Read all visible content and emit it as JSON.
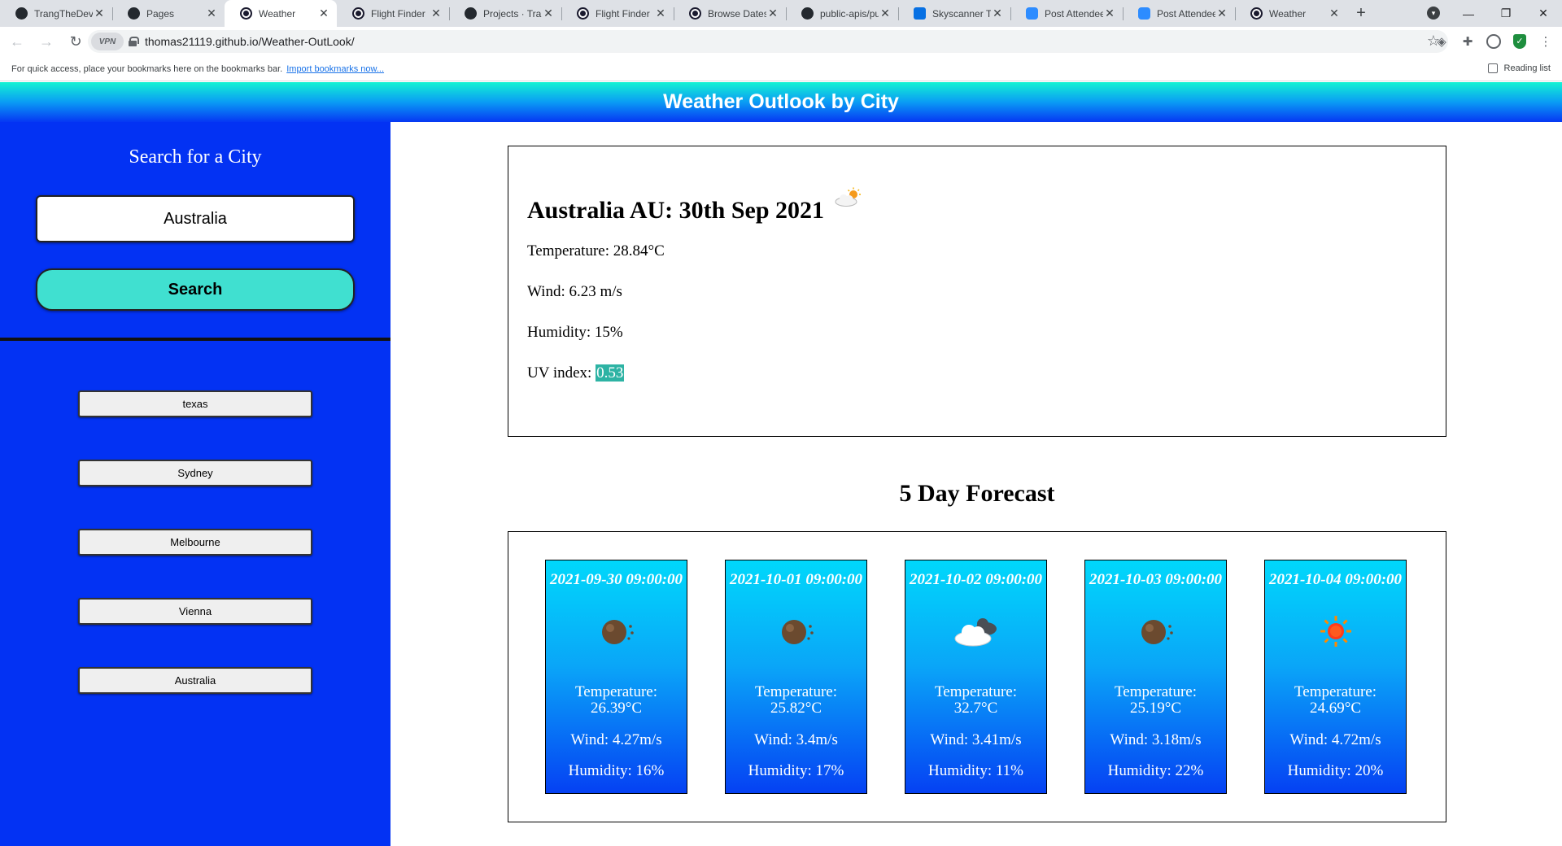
{
  "browser": {
    "tabs": [
      {
        "title": "TrangTheDev",
        "icon": "github-icon"
      },
      {
        "title": "Pages",
        "icon": "github-icon"
      },
      {
        "title": "Weather",
        "icon": "globe-icon",
        "active": true
      },
      {
        "title": "Flight Finder",
        "icon": "globe-icon"
      },
      {
        "title": "Projects · Tran",
        "icon": "github-icon"
      },
      {
        "title": "Flight Finder",
        "icon": "globe-icon"
      },
      {
        "title": "Browse Dates",
        "icon": "globe-icon"
      },
      {
        "title": "public-apis/pu",
        "icon": "github-icon"
      },
      {
        "title": "Skyscanner Tr",
        "icon": "skyscanner-icon"
      },
      {
        "title": "Post Attendee",
        "icon": "zoom-icon"
      },
      {
        "title": "Post Attendee",
        "icon": "zoom-icon"
      },
      {
        "title": "Weather",
        "icon": "globe-icon"
      }
    ],
    "vpn_label": "VPN",
    "url": "thomas21119.github.io/Weather-OutLook/",
    "bookmarks_prompt": "For quick access, place your bookmarks here on the bookmarks bar.",
    "bookmarks_link": "Import bookmarks now...",
    "reading_list": "Reading list"
  },
  "app": {
    "title": "Weather Outlook by City"
  },
  "sidebar": {
    "heading": "Search for a City",
    "search_value": "Australia",
    "search_button": "Search",
    "history": [
      "texas",
      "Sydney",
      "Melbourne",
      "Vienna",
      "Australia"
    ]
  },
  "current": {
    "heading": "Australia AU: 30th Sep 2021",
    "icon": "partly-cloudy-icon",
    "temperature": "Temperature: 28.84°C",
    "wind": "Wind: 6.23 m/s",
    "humidity": "Humidity: 15%",
    "uv_label": "UV index:",
    "uv_value": "0.53",
    "uv_color": "#2db3a4"
  },
  "forecast": {
    "title": "5 Day Forecast",
    "days": [
      {
        "date": "2021-09-30 09:00:00",
        "icon": "dust-icon",
        "temp_label": "Temperature:",
        "temp": "26.39°C",
        "wind": "Wind: 4.27m/s",
        "humidity": "Humidity: 16%"
      },
      {
        "date": "2021-10-01 09:00:00",
        "icon": "dust-icon",
        "temp_label": "Temperature:",
        "temp": "25.82°C",
        "wind": "Wind: 3.4m/s",
        "humidity": "Humidity: 17%"
      },
      {
        "date": "2021-10-02 09:00:00",
        "icon": "broken-clouds-icon",
        "temp_label": "Temperature:",
        "temp": "32.7°C",
        "wind": "Wind: 3.41m/s",
        "humidity": "Humidity: 11%"
      },
      {
        "date": "2021-10-03 09:00:00",
        "icon": "dust-icon",
        "temp_label": "Temperature:",
        "temp": "25.19°C",
        "wind": "Wind: 3.18m/s",
        "humidity": "Humidity: 22%"
      },
      {
        "date": "2021-10-04 09:00:00",
        "icon": "clear-sun-icon",
        "temp_label": "Temperature:",
        "temp": "24.69°C",
        "wind": "Wind: 4.72m/s",
        "humidity": "Humidity: 20%"
      }
    ]
  }
}
